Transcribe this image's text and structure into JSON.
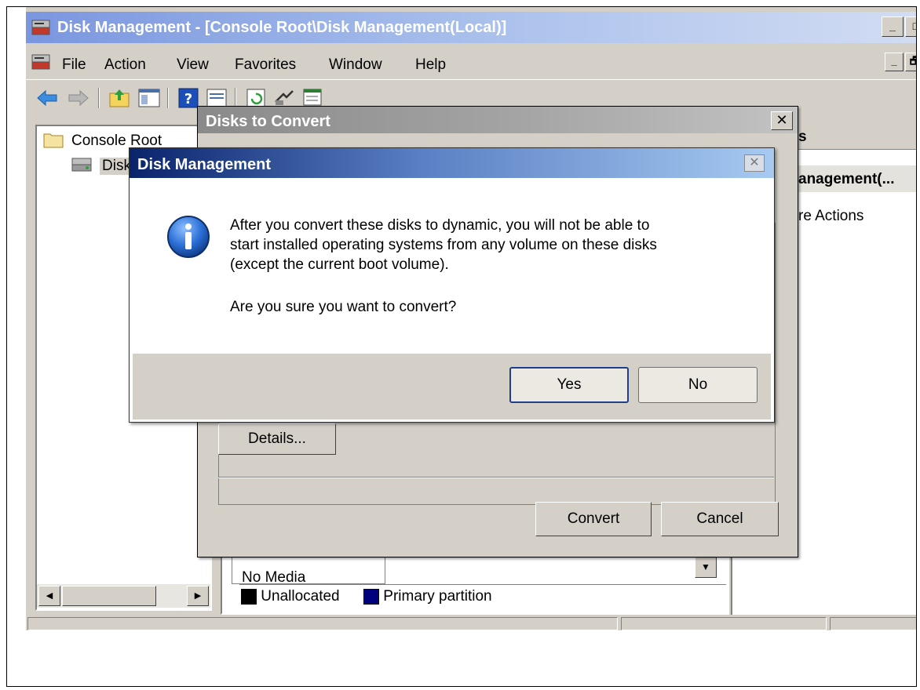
{
  "main_window": {
    "title": "Disk Management - [Console Root\\Disk Management(Local)]",
    "title_controls": {
      "minimize": "_",
      "maximize": "□"
    },
    "menu": [
      "File",
      "Action",
      "View",
      "Favorites",
      "Window",
      "Help"
    ],
    "mdi_controls": {
      "minimize": "_",
      "restore": "🗗"
    },
    "toolbar_icons": [
      "back-arrow-icon",
      "forward-arrow-icon",
      "up-folder-icon",
      "show-hide-tree-icon",
      "help-icon",
      "view-icon",
      "refresh-icon",
      "rescan-icon",
      "properties-icon"
    ]
  },
  "tree": {
    "items": [
      {
        "label": "Console Root",
        "icon": "folder-icon"
      },
      {
        "label": "Disk",
        "icon": "disk-management-icon"
      }
    ]
  },
  "actions_pane": {
    "header": "s",
    "section": "anagement(...",
    "item": "re Actions"
  },
  "center_pane": {
    "no_media_text": "No Media",
    "legend": [
      {
        "label": "Unallocated",
        "color": "#000000"
      },
      {
        "label": "Primary partition",
        "color": "#00007f"
      }
    ]
  },
  "disks_to_convert_dialog": {
    "title": "Disks to Convert",
    "close": "✕",
    "details_button": "Details...",
    "convert_button": "Convert",
    "cancel_button": "Cancel"
  },
  "disk_management_dialog": {
    "title": "Disk Management",
    "close": "✕",
    "message_lines": [
      "After you convert these disks to dynamic, you will not be able to",
      "start installed operating systems from any volume on these disks",
      "(except the current boot volume)."
    ],
    "question": "Are you sure you want to convert?",
    "yes_button": "Yes",
    "no_button": "No",
    "icon": "information-icon"
  },
  "colors": {
    "window_bg": "#d4d0c8",
    "active_title": "#0a246a",
    "inactive_title": "#8a8a8a",
    "info_icon_blue": "#1f5fc4"
  }
}
